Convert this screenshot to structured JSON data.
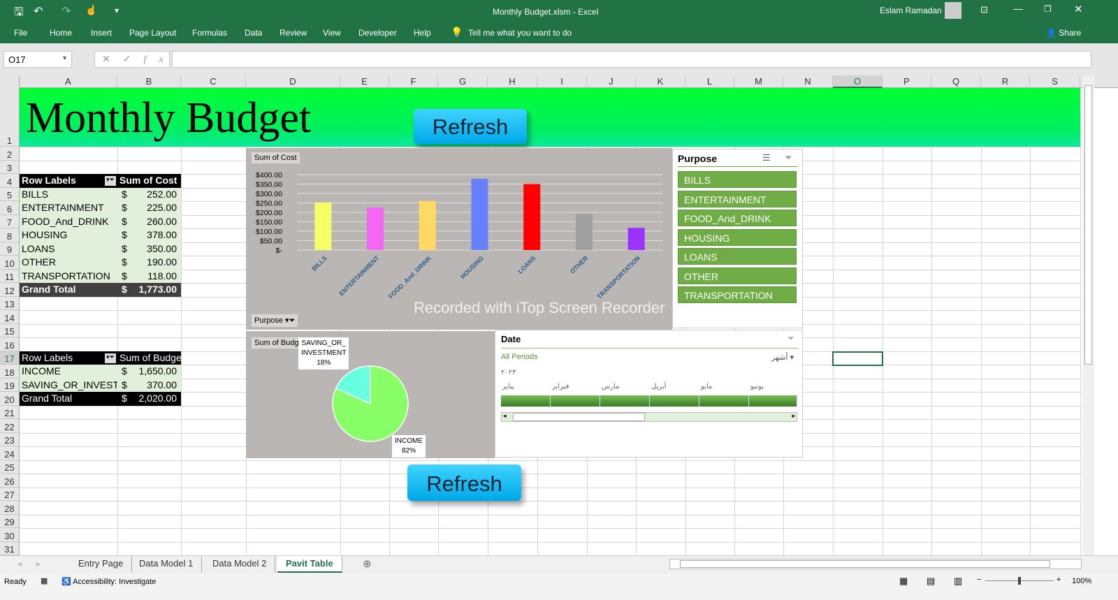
{
  "window": {
    "title": "Monthly Budget.xlsm  -  Excel",
    "user": "Eslam Ramadan",
    "share": "Share"
  },
  "ribbon_tabs": [
    "File",
    "Home",
    "Insert",
    "Page Layout",
    "Formulas",
    "Data",
    "Review",
    "View",
    "Developer",
    "Help"
  ],
  "tell_me": "Tell me what you want to do",
  "name_box": "O17",
  "formula": "",
  "columns": [
    "A",
    "B",
    "C",
    "D",
    "E",
    "F",
    "G",
    "H",
    "I",
    "J",
    "K",
    "L",
    "M",
    "N",
    "O",
    "P",
    "Q",
    "R",
    "S"
  ],
  "selected_column": "O",
  "sheet_title": "Monthly Budget",
  "refresh_label": "Refresh",
  "pivot1": {
    "header": [
      "Row Labels",
      "Sum of Cost"
    ],
    "rows": [
      [
        "BILLS",
        "$",
        "252.00"
      ],
      [
        "ENTERTAINMENT",
        "$",
        "225.00"
      ],
      [
        "FOOD_And_DRINK",
        "$",
        "260.00"
      ],
      [
        "HOUSING",
        "$",
        "378.00"
      ],
      [
        "LOANS",
        "$",
        "350.00"
      ],
      [
        "OTHER",
        "$",
        "190.00"
      ],
      [
        "TRANSPORTATION",
        "$",
        "118.00"
      ]
    ],
    "total": [
      "Grand Total",
      "$",
      "1,773.00"
    ]
  },
  "pivot2": {
    "header": [
      "Row Labels",
      "Sum of Budget"
    ],
    "rows": [
      [
        "INCOME",
        "$",
        "1,650.00"
      ],
      [
        "SAVING_OR_INVESTMENT",
        "$",
        "370.00"
      ]
    ],
    "total": [
      "Grand Total",
      "$",
      "2,020.00"
    ]
  },
  "chart_data": [
    {
      "type": "bar",
      "title": "Sum of Cost",
      "categories": [
        "BILLS",
        "ENTERTAINMENT",
        "FOOD_And_DRINK",
        "HOUSING",
        "LOANS",
        "OTHER",
        "TRANSPORTATION"
      ],
      "values": [
        252,
        225,
        260,
        378,
        350,
        190,
        118
      ],
      "colors": [
        "#f5ff66",
        "#f566f5",
        "#ffd966",
        "#6680ff",
        "#ff0000",
        "#a0a0a0",
        "#9933ff"
      ],
      "yticks": [
        "$-",
        "$50.00",
        "$100.00",
        "$150.00",
        "$200.00",
        "$250.00",
        "$300.00",
        "$350.00",
        "$400.00"
      ],
      "ylim": [
        0,
        400
      ],
      "grid": true,
      "filter_button": "Purpose"
    },
    {
      "type": "pie",
      "title": "Sum of Budget",
      "categories": [
        "SAVING_OR_INVESTMENT",
        "INCOME"
      ],
      "values": [
        370,
        1650
      ],
      "labels": [
        [
          "SAVING_OR_",
          "INVESTMENT",
          "18%"
        ],
        [
          "INCOME",
          "82%"
        ]
      ],
      "colors": [
        "#66ffe0",
        "#88ff66"
      ]
    }
  ],
  "purpose_slicer": {
    "title": "Purpose",
    "items": [
      "BILLS",
      "ENTERTAINMENT",
      "FOOD_And_DRINK",
      "HOUSING",
      "LOANS",
      "OTHER",
      "TRANSPORTATION"
    ]
  },
  "date_slicer": {
    "title": "Date",
    "all_periods": "All Periods",
    "level": "أشهر",
    "year": "٢٠٢٣",
    "months": [
      "يناير",
      "فبراير",
      "مارس",
      "أبريل",
      "مايو",
      "يونيو"
    ]
  },
  "watermark": "Recorded with iTop Screen Recorder",
  "sheets": [
    "Entry Page",
    "Data Model 1",
    "Data Model 2",
    "Pavit Table"
  ],
  "active_sheet": "Pavit Table",
  "status": {
    "ready": "Ready",
    "accessibility": "Accessibility: Investigate",
    "zoom": "100%"
  }
}
